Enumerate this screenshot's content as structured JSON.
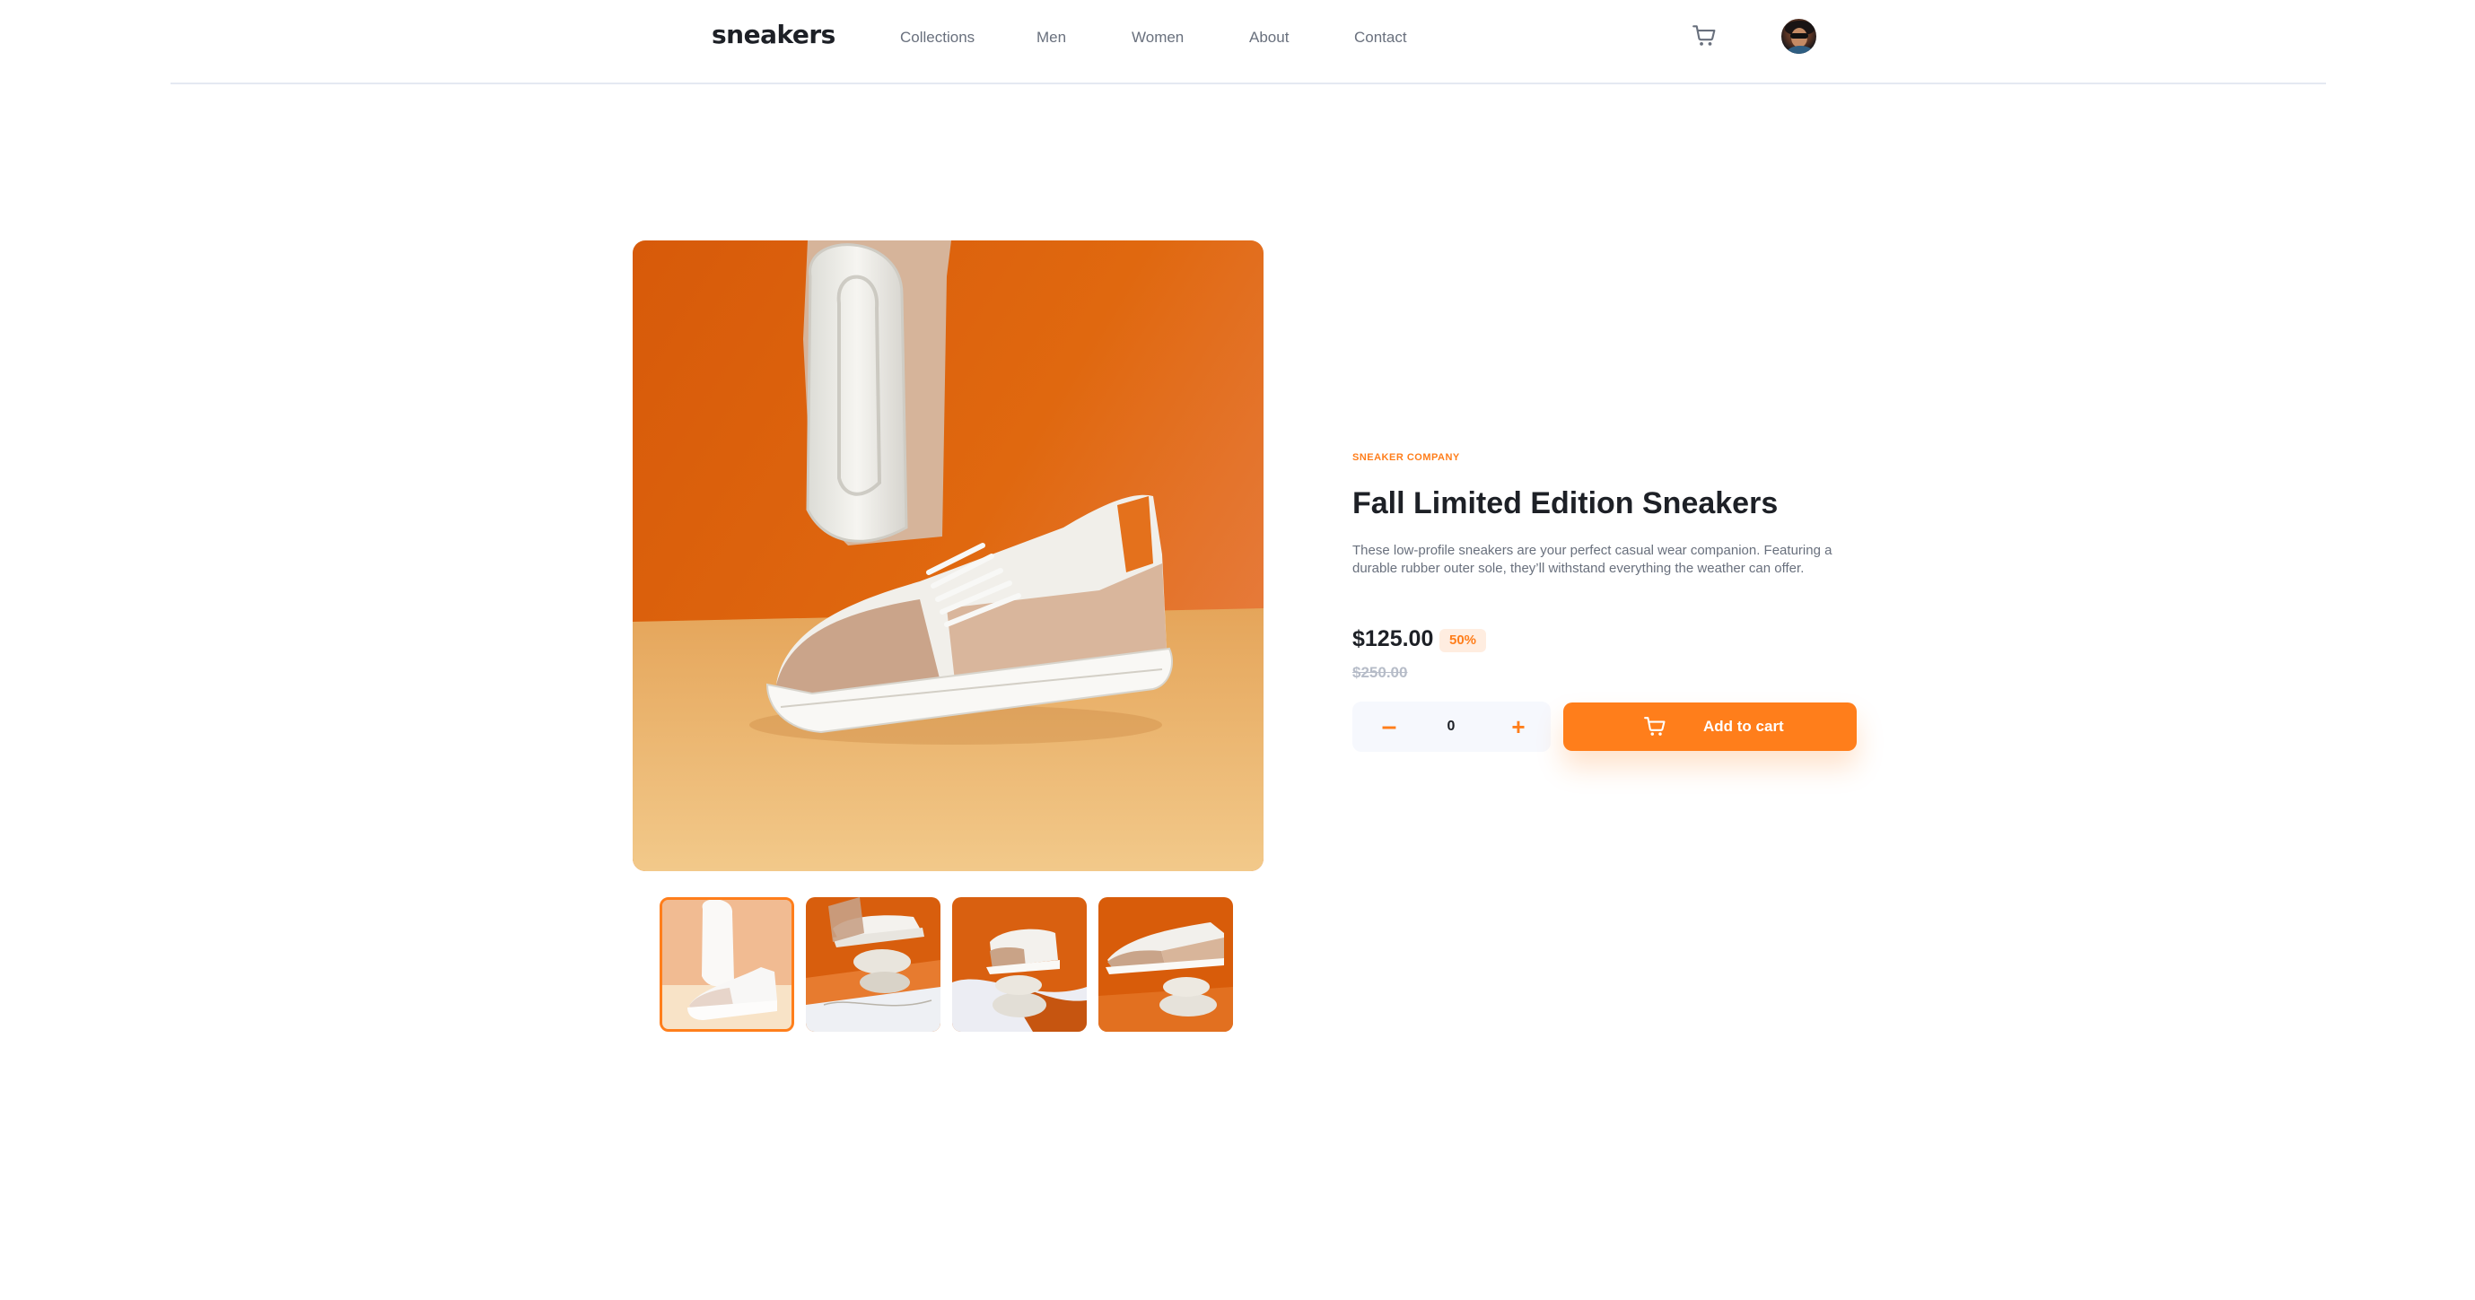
{
  "header": {
    "logo": "sneakers",
    "nav": [
      "Collections",
      "Men",
      "Women",
      "About",
      "Contact"
    ],
    "cart_icon": "cart-icon",
    "avatar_icon": "user-avatar"
  },
  "product": {
    "company": "Sneaker Company",
    "title": "Fall Limited Edition Sneakers",
    "description": "These low-profile sneakers are your perfect casual wear companion. Featuring a durable rubber outer sole, they’ll withstand everything the weather can offer.",
    "price": "$125.00",
    "discount": "50%",
    "original_price": "$250.00",
    "quantity": "0",
    "minus_symbol": "–",
    "plus_symbol": "+",
    "add_to_cart": "Add to cart"
  },
  "gallery": {
    "thumbnail_count": 4,
    "active_thumbnail": 1
  },
  "colors": {
    "accent": "#ff7e1b",
    "accent_pale": "#ffede0",
    "text_dark": "#1d2026",
    "text_grey": "#69707d",
    "muted": "#b6bcc8",
    "background_light": "#f6f8fd"
  }
}
